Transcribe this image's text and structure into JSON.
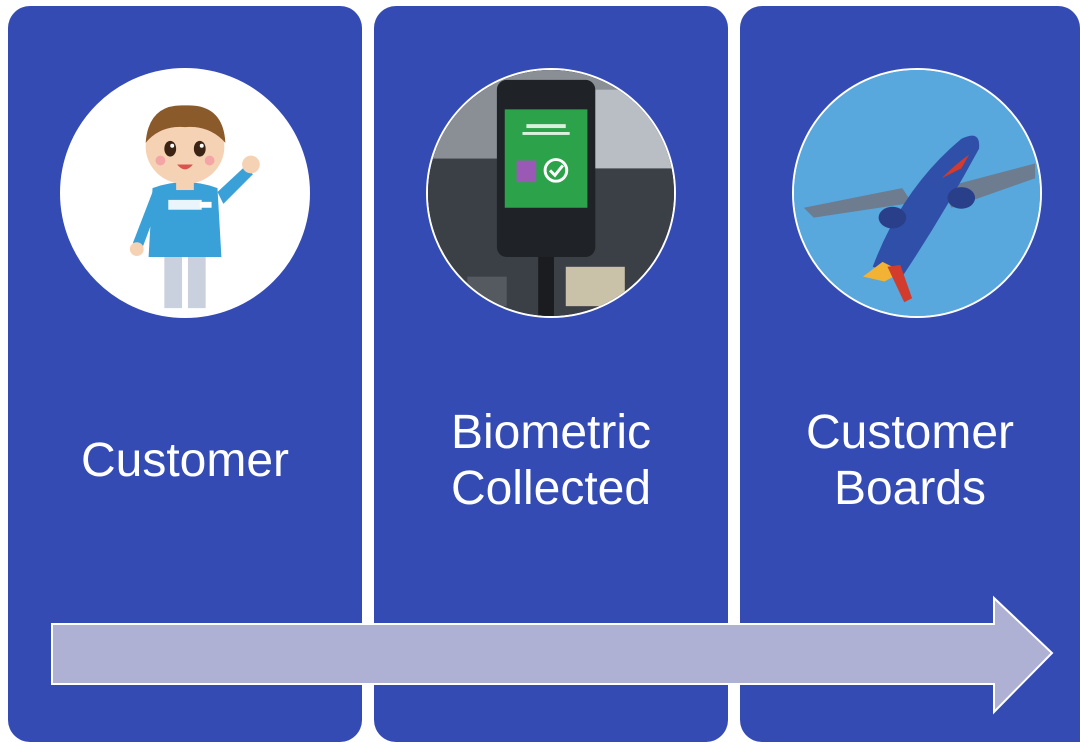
{
  "colors": {
    "panel": "#344bb4",
    "arrow_fill": "#aeb1d3",
    "arrow_stroke": "#ffffff",
    "text": "#ffffff"
  },
  "steps": [
    {
      "label": "Customer",
      "image": "cartoon-person-waving"
    },
    {
      "label": "Biometric\nCollected",
      "image": "biometric-kiosk-photo"
    },
    {
      "label": "Customer\nBoards",
      "image": "airplane-takeoff-photo"
    }
  ],
  "flow_direction": "left-to-right"
}
